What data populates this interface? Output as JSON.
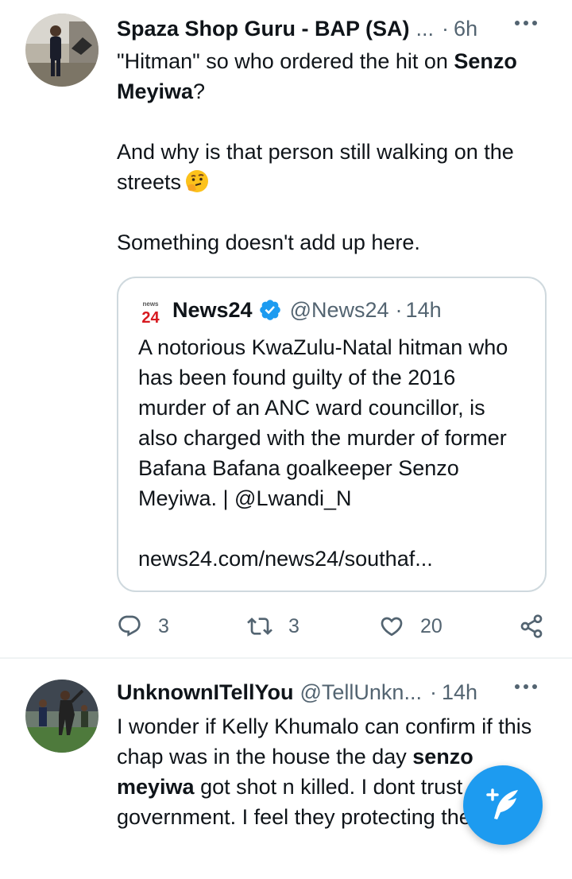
{
  "tweets": [
    {
      "author": {
        "name": "Spaza Shop Guru - BAP (SA)",
        "handle": "...",
        "time": "6h"
      },
      "body": {
        "line1_pre": "\"Hitman\" so who ordered the hit on ",
        "line1_bold": "Senzo Meyiwa",
        "line1_post": "?",
        "para2": "And why is that person still walking on the streets",
        "para3": "Something doesn't add up here."
      },
      "quote": {
        "logo_top": "news",
        "logo_num": "24",
        "name": "News24",
        "handle": "@News24",
        "time": "14h",
        "body": "A notorious KwaZulu-Natal hitman who has been found guilty of the 2016 murder of an ANC ward councillor, is also charged with the murder of former Bafana Bafana goalkeeper Senzo Meyiwa. | @Lwandi_N",
        "link": "news24.com/news24/southaf..."
      },
      "actions": {
        "replies": "3",
        "retweets": "3",
        "likes": "20"
      }
    },
    {
      "author": {
        "name": "UnknownITellYou",
        "handle": "@TellUnkn...",
        "time": "14h"
      },
      "body": {
        "pre": "I wonder if Kelly Khumalo can confirm if this chap was in the house the day ",
        "bold": "senzo meyiwa",
        "post": " got shot n killed. I dont trust government. I feel they protecting the killers"
      }
    }
  ],
  "colors": {
    "accent": "#1d9bf0",
    "secondary_text": "#536471",
    "border": "#cfd9de",
    "news24_red": "#d7191f"
  },
  "icons": [
    "more-icon",
    "emoji-thinking",
    "verified-badge",
    "reply-icon",
    "retweet-icon",
    "like-icon",
    "share-icon",
    "compose-icon"
  ]
}
